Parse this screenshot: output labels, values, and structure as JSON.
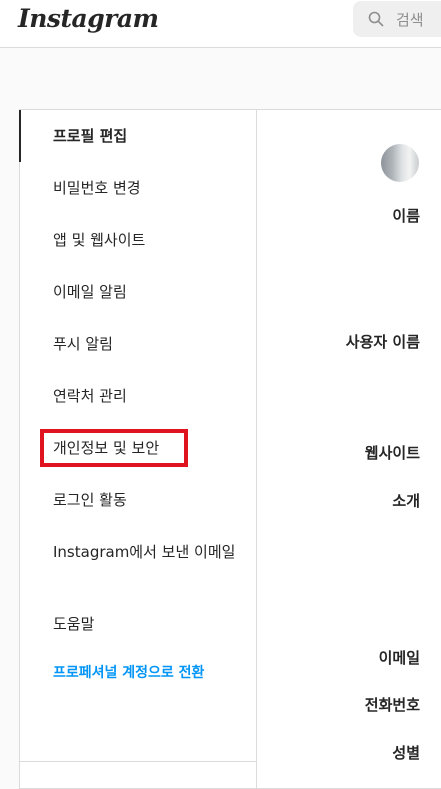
{
  "header": {
    "logo": "Instagram",
    "search_placeholder": "검색"
  },
  "sidebar": {
    "items": [
      {
        "label": "프로필 편집"
      },
      {
        "label": "비밀번호 변경"
      },
      {
        "label": "앱 및 웹사이트"
      },
      {
        "label": "이메일 알림"
      },
      {
        "label": "푸시 알림"
      },
      {
        "label": "연락처 관리"
      },
      {
        "label": "개인정보 및 보안"
      },
      {
        "label": "로그인 활동"
      },
      {
        "label": "Instagram에서 보낸 이메일"
      },
      {
        "label": "도움말"
      }
    ],
    "pro_link": "프로페셔널 계정으로 전환"
  },
  "form": {
    "name_label": "이름",
    "username_label": "사용자 이름",
    "website_label": "웹사이트",
    "bio_label": "소개",
    "email_label": "이메일",
    "phone_label": "전화번호",
    "gender_label": "성별"
  }
}
